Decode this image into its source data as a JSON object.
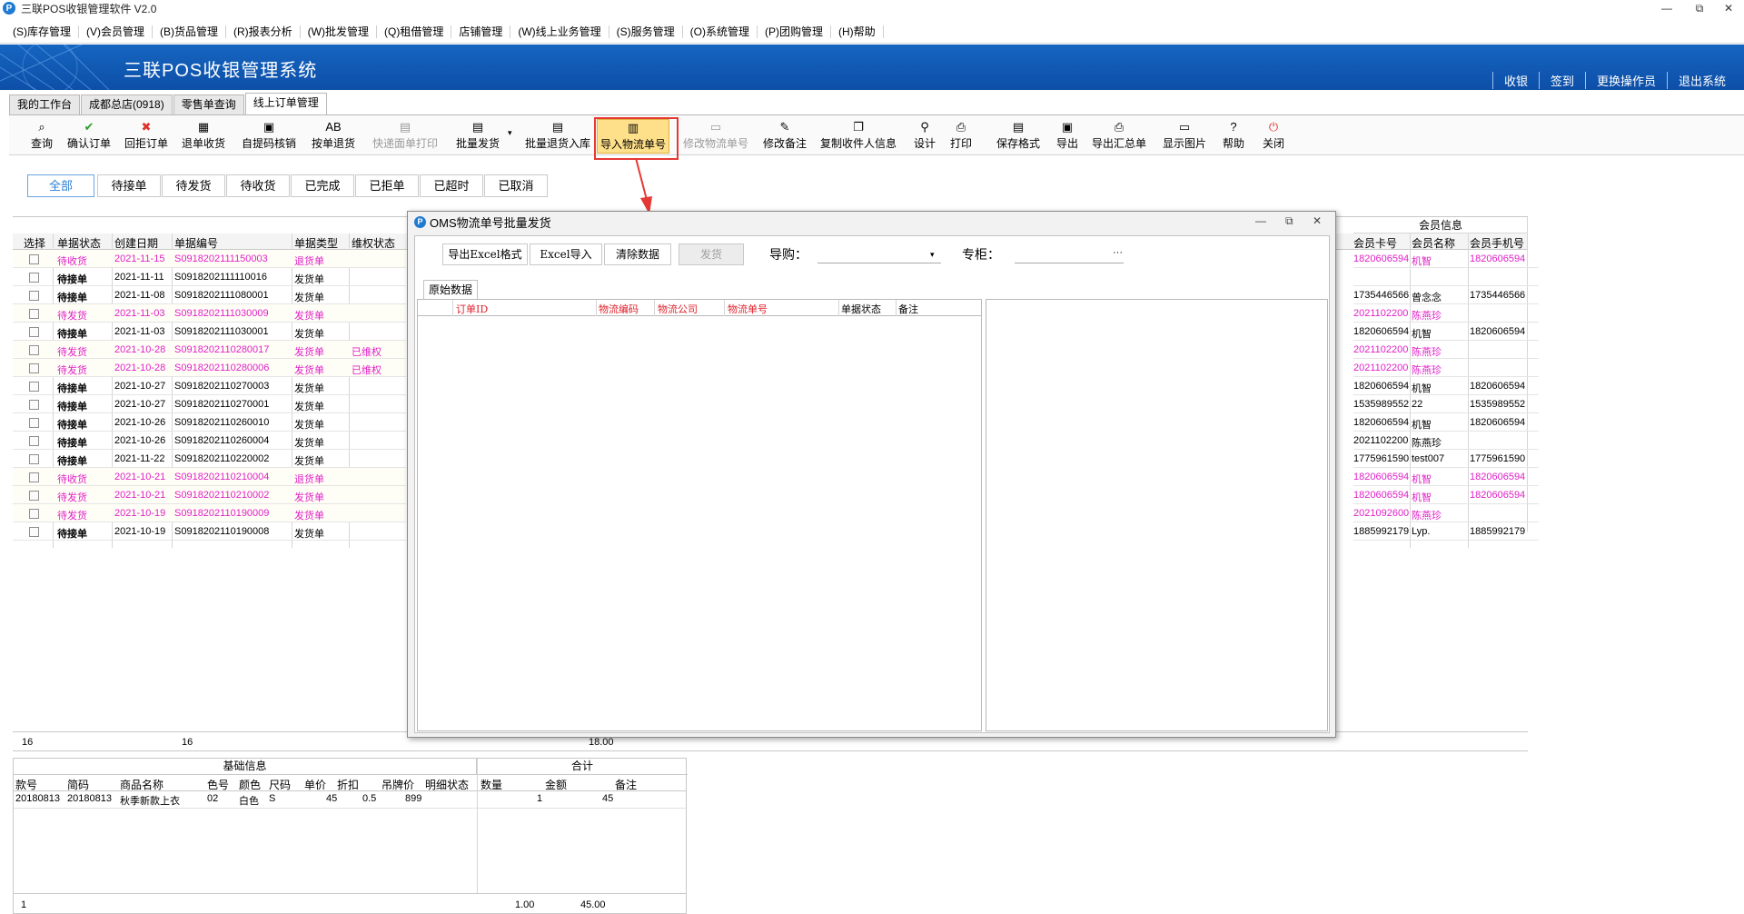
{
  "app": {
    "title": "三联POS收银管理软件 V2.0",
    "logo_letter": "P"
  },
  "window_controls": {
    "minimize": "—",
    "restore": "⧉",
    "close": "✕"
  },
  "menu": [
    "(S)库存管理",
    "(V)会员管理",
    "(B)货品管理",
    "(R)报表分析",
    "(W)批发管理",
    "(Q)租借管理",
    "店铺管理",
    "(W)线上业务管理",
    "(S)服务管理",
    "(O)系统管理",
    "(P)团购管理",
    "(H)帮助"
  ],
  "banner": {
    "title": "三联POS收银管理系统",
    "links": [
      "收银",
      "签到",
      "更换操作员",
      "退出系统"
    ]
  },
  "tabs": [
    "我的工作台",
    "成都总店(0918)",
    "零售单查询",
    "线上订单管理"
  ],
  "toolbar": [
    {
      "label": "查询",
      "icon": "search-icon",
      "disabled": false
    },
    {
      "label": "确认订单",
      "icon": "check-icon",
      "disabled": false
    },
    {
      "label": "回拒订单",
      "icon": "reject-icon",
      "disabled": false
    },
    {
      "label": "退单收货",
      "icon": "return-icon",
      "disabled": false
    },
    {
      "label": "自提码核销",
      "icon": "basket-icon",
      "disabled": false
    },
    {
      "label": "按单退货",
      "icon": "ab-icon",
      "disabled": false
    },
    {
      "label": "快递面单打印",
      "icon": "print-label-icon",
      "disabled": true
    },
    {
      "label": "批量发货",
      "icon": "batch-ship-icon",
      "disabled": false
    },
    {
      "label": "批量退货入库",
      "icon": "batch-return-icon",
      "disabled": false
    },
    {
      "label": "导入物流单号",
      "icon": "import-logistics-icon",
      "disabled": false,
      "highlight": true
    },
    {
      "label": "修改物流单号",
      "icon": "edit-logistics-icon",
      "disabled": true
    },
    {
      "label": "修改备注",
      "icon": "edit-note-icon",
      "disabled": false
    },
    {
      "label": "复制收件人信息",
      "icon": "copy-icon",
      "disabled": false
    },
    {
      "label": "设计",
      "icon": "design-icon",
      "disabled": false
    },
    {
      "label": "打印",
      "icon": "print-icon",
      "disabled": false
    },
    {
      "label": "保存格式",
      "icon": "save-format-icon",
      "disabled": false
    },
    {
      "label": "导出",
      "icon": "export-icon",
      "disabled": false
    },
    {
      "label": "导出汇总单",
      "icon": "export-summary-icon",
      "disabled": false
    },
    {
      "label": "显示图片",
      "icon": "image-icon",
      "disabled": false
    },
    {
      "label": "帮助",
      "icon": "help-icon",
      "disabled": false
    },
    {
      "label": "关闭",
      "icon": "power-icon",
      "disabled": false
    }
  ],
  "status_filters": [
    "全部",
    "待接单",
    "待发货",
    "待收货",
    "已完成",
    "已拒单",
    "已超时",
    "已取消"
  ],
  "grid": {
    "headers": [
      "选择",
      "单据状态",
      "创建日期",
      "单据编号",
      "单据类型",
      "维权状态"
    ],
    "member_group": "会员信息",
    "member_headers": [
      "会员卡号",
      "会员名称",
      "会员手机号"
    ],
    "rows": [
      {
        "status": "待收货",
        "date": "2021-11-15",
        "no": "S0918202111150003",
        "type": "退货单",
        "rights": "",
        "pink": true,
        "card": "1820606594",
        "name": "机智",
        "phone": "1820606594"
      },
      {
        "status": "待接单",
        "date": "2021-11-11",
        "no": "S0918202111110016",
        "type": "发货单",
        "rights": "",
        "pink": false,
        "card": "",
        "name": "",
        "phone": ""
      },
      {
        "status": "待接单",
        "date": "2021-11-08",
        "no": "S0918202111080001",
        "type": "发货单",
        "rights": "",
        "pink": false,
        "card": "1735446566",
        "name": "曾念念",
        "phone": "1735446566"
      },
      {
        "status": "待发货",
        "date": "2021-11-03",
        "no": "S0918202111030009",
        "type": "发货单",
        "rights": "",
        "pink": true,
        "card": "2021102200",
        "name": "陈燕珍",
        "phone": ""
      },
      {
        "status": "待接单",
        "date": "2021-11-03",
        "no": "S0918202111030001",
        "type": "发货单",
        "rights": "",
        "pink": false,
        "card": "1820606594",
        "name": "机智",
        "phone": "1820606594"
      },
      {
        "status": "待发货",
        "date": "2021-10-28",
        "no": "S0918202110280017",
        "type": "发货单",
        "rights": "已维权",
        "pink": true,
        "card": "2021102200",
        "name": "陈燕珍",
        "phone": ""
      },
      {
        "status": "待发货",
        "date": "2021-10-28",
        "no": "S0918202110280006",
        "type": "发货单",
        "rights": "已维权",
        "pink": true,
        "card": "2021102200",
        "name": "陈燕珍",
        "phone": ""
      },
      {
        "status": "待接单",
        "date": "2021-10-27",
        "no": "S0918202110270003",
        "type": "发货单",
        "rights": "",
        "pink": false,
        "card": "1820606594",
        "name": "机智",
        "phone": "1820606594"
      },
      {
        "status": "待接单",
        "date": "2021-10-27",
        "no": "S0918202110270001",
        "type": "发货单",
        "rights": "",
        "pink": false,
        "card": "1535989552",
        "name": "22",
        "phone": "1535989552"
      },
      {
        "status": "待接单",
        "date": "2021-10-26",
        "no": "S0918202110260010",
        "type": "发货单",
        "rights": "",
        "pink": false,
        "card": "1820606594",
        "name": "机智",
        "phone": "1820606594"
      },
      {
        "status": "待接单",
        "date": "2021-10-26",
        "no": "S0918202110260004",
        "type": "发货单",
        "rights": "",
        "pink": false,
        "card": "2021102200",
        "name": "陈燕珍",
        "phone": ""
      },
      {
        "status": "待接单",
        "date": "2021-11-22",
        "no": "S0918202110220002",
        "type": "发货单",
        "rights": "",
        "pink": false,
        "card": "1775961590",
        "name": "test007",
        "phone": "1775961590"
      },
      {
        "status": "待收货",
        "date": "2021-10-21",
        "no": "S0918202110210004",
        "type": "退货单",
        "rights": "",
        "pink": true,
        "card": "1820606594",
        "name": "机智",
        "phone": "1820606594"
      },
      {
        "status": "待发货",
        "date": "2021-10-21",
        "no": "S0918202110210002",
        "type": "发货单",
        "rights": "",
        "pink": true,
        "card": "1820606594",
        "name": "机智",
        "phone": "1820606594"
      },
      {
        "status": "待发货",
        "date": "2021-10-19",
        "no": "S0918202110190009",
        "type": "发货单",
        "rights": "",
        "pink": true,
        "card": "2021092600",
        "name": "陈燕珍",
        "phone": ""
      },
      {
        "status": "待接单",
        "date": "2021-10-19",
        "no": "S0918202110190008",
        "type": "发货单",
        "rights": "",
        "pink": false,
        "card": "1885992179",
        "name": "Lyp.",
        "phone": "1885992179"
      }
    ],
    "footer": {
      "count": "16",
      "count2": "16",
      "total": "18.00"
    }
  },
  "detail": {
    "group_basic": "基础信息",
    "group_total": "合计",
    "headers": [
      "款号",
      "简码",
      "商品名称",
      "色号",
      "颜色",
      "尺码",
      "单价",
      "折扣",
      "吊牌价",
      "明细状态",
      "数量",
      "金额",
      "备注"
    ],
    "row": [
      "20180813",
      "20180813",
      "秋季新款上衣",
      "02",
      "白色",
      "S",
      "45",
      "0.5",
      "899",
      "",
      "1",
      "45",
      ""
    ],
    "footer": {
      "count": "1",
      "qty": "1.00",
      "amount": "45.00"
    }
  },
  "dialog": {
    "title": "OMS物流单号批量发货",
    "buttons": [
      "导出Excel格式",
      "Excel导入",
      "清除数据",
      "发货"
    ],
    "guide_label": "导购：",
    "counter_label": "专柜：",
    "counter_btn": "···",
    "tab": "原始数据",
    "columns": [
      "订单ID",
      "物流编码",
      "物流公司",
      "物流单号",
      "单据状态",
      "备注"
    ]
  }
}
